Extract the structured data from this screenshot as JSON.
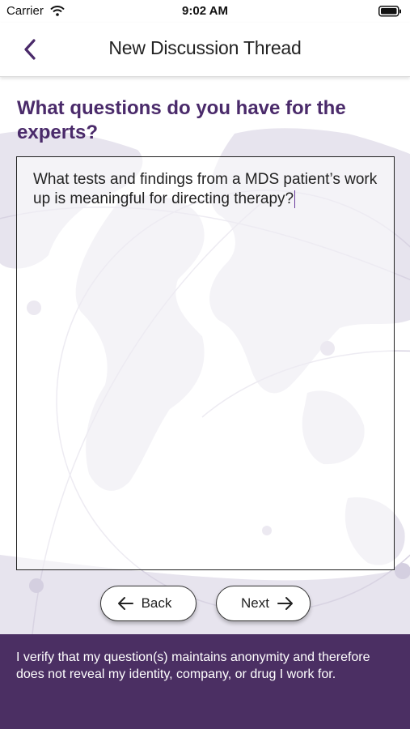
{
  "status_bar": {
    "carrier": "Carrier",
    "time": "9:02 AM"
  },
  "navbar": {
    "title": "New Discussion Thread"
  },
  "main": {
    "question_heading": "What questions do you have for the experts?",
    "question_text": "What tests and findings from a MDS patient’s work up is meaningful for directing therapy?"
  },
  "buttons": {
    "back_label": "Back",
    "next_label": "Next"
  },
  "footer": {
    "disclaimer": "I verify that my question(s) maintains anonymity and therefore does not reveal my identity, company, or drug I work for."
  },
  "colors": {
    "accent": "#4a2a6a",
    "footer_bg": "#4b2f63",
    "map": "#e7e4ee"
  }
}
